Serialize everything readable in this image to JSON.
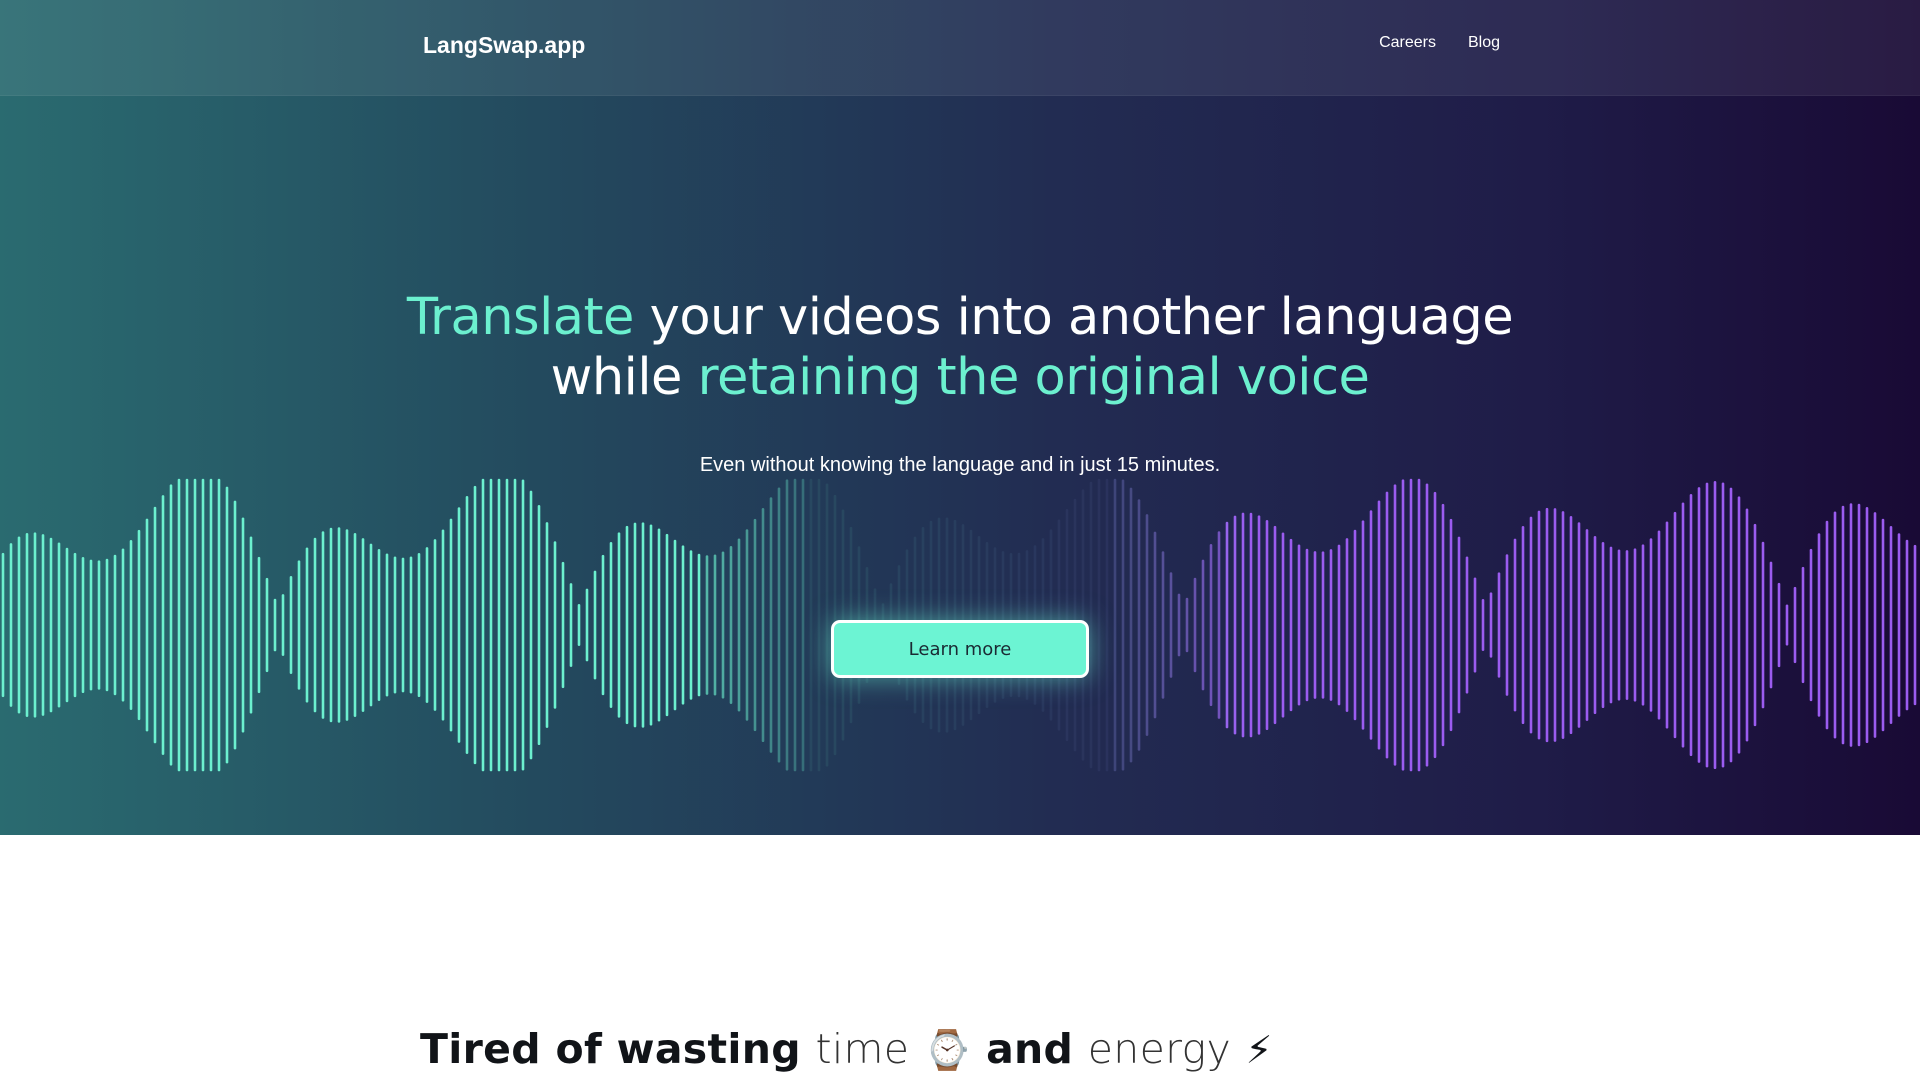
{
  "header": {
    "brand": "LangSwap.app",
    "nav": [
      {
        "label": "Careers"
      },
      {
        "label": "Blog"
      }
    ]
  },
  "hero": {
    "headline": {
      "line1_accent": "Translate",
      "line1_rest": " your videos into another language",
      "line2_plain": "while ",
      "line2_accent": "retaining the original voice"
    },
    "subtitle": "Even without knowing the language and in just 15 minutes.",
    "cta_label": "Learn more"
  },
  "section": {
    "title_part1": "Tired of wasting ",
    "title_time": "time",
    "title_time_emoji": "⌚",
    "title_and": " and ",
    "title_energy": "energy",
    "title_energy_emoji": "⚡"
  },
  "colors": {
    "accent_teal": "#6cf0cf",
    "wave_purple": "#9b5cf0",
    "hero_left": "#2a6b70",
    "hero_right": "#190a35"
  },
  "icons": {
    "waveform": "sound-wave-decoration"
  }
}
